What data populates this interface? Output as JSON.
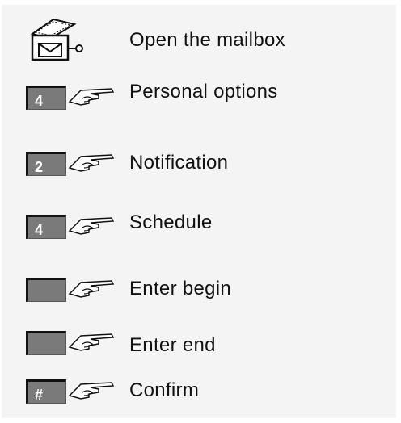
{
  "steps": [
    {
      "icon": "mailbox-icon",
      "key": "",
      "label": "Open the mailbox"
    },
    {
      "icon": "key-hand-icon",
      "key": "4",
      "label": "Personal options"
    },
    {
      "icon": "key-hand-icon",
      "key": "2",
      "label": "Notification"
    },
    {
      "icon": "key-hand-icon",
      "key": "4",
      "label": "Schedule"
    },
    {
      "icon": "key-hand-icon",
      "key": "",
      "label": "Enter begin"
    },
    {
      "icon": "key-hand-icon",
      "key": "",
      "label": "Enter end"
    },
    {
      "icon": "key-hand-icon",
      "key": "#",
      "label": "Confirm"
    }
  ],
  "colors": {
    "key_fill": "#7a7a7a",
    "key_border": "#111111",
    "background": "#f4f4f4"
  }
}
